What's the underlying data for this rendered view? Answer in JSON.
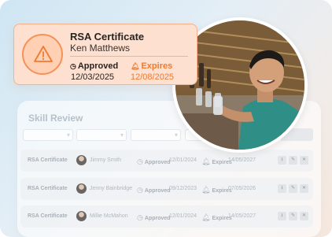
{
  "card": {
    "title": "RSA Certificate",
    "name": "Ken Matthews",
    "approved_label": "Approved",
    "approved_date": "12/03/2025",
    "expires_label": "Expires",
    "expires_date": "12/08/2025",
    "warning_icon": "warning-triangle-icon",
    "accent": "#ef7a32",
    "background": "#fde0d0"
  },
  "panel": {
    "title": "Skill Review",
    "filters": [
      "",
      "",
      "",
      ""
    ],
    "rows": [
      {
        "cert": "RSA Certificate",
        "name": "Jimmy Smith",
        "approved_label": "Approved",
        "approved_date": "12/01/2024",
        "expires_label": "Expires",
        "expires_date": "14/05/2027"
      },
      {
        "cert": "RSA Certificate",
        "name": "Jenny Bainbridge",
        "approved_label": "Approved",
        "approved_date": "09/12/2023",
        "expires_label": "Expires",
        "expires_date": "07/05/2026"
      },
      {
        "cert": "RSA Certificate",
        "name": "Millie McMahon",
        "approved_label": "Approved",
        "approved_date": "12/01/2024",
        "expires_label": "Expires",
        "expires_date": "14/05/2027"
      }
    ],
    "row_actions": [
      "download-icon",
      "edit-icon",
      "close-icon"
    ]
  },
  "photo": {
    "subject": "person-photo"
  }
}
